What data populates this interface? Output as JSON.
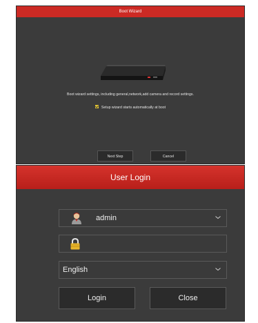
{
  "boot_wizard": {
    "title": "Boot Wizard",
    "description": "Boot wizard settings, including general,network,add camera and record settings.",
    "autostart_label": "Setup wizard starts automatically at boot",
    "autostart_checked": true,
    "buttons": {
      "next": "Next Step",
      "cancel": "Cancel"
    },
    "colors": {
      "titlebar": "#cc2a24",
      "panel": "#3b3b3b",
      "checkbox": "#e3c531"
    }
  },
  "user_login": {
    "title": "User Login",
    "username": {
      "value": "admin",
      "icon": "user-icon"
    },
    "password": {
      "value": "",
      "icon": "lock-icon"
    },
    "language": {
      "selected": "English"
    },
    "buttons": {
      "login": "Login",
      "close": "Close"
    },
    "colors": {
      "titlebar": "#c8261f",
      "panel": "#3b3b3b"
    }
  }
}
